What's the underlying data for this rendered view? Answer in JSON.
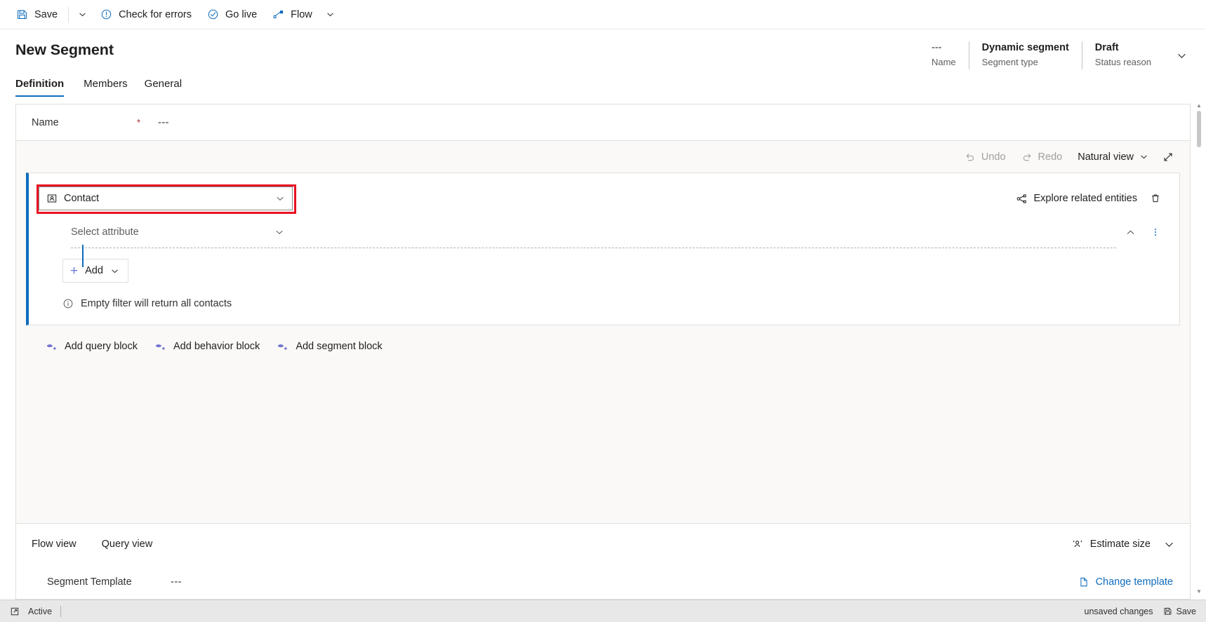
{
  "command_bar": {
    "items": [
      {
        "label": "Save",
        "icon": "save-icon",
        "name": "save-button"
      },
      {
        "label": "Check for errors",
        "icon": "error-circle-icon",
        "name": "check-for-errors-button"
      },
      {
        "label": "Go live",
        "icon": "checkmark-circle-icon",
        "name": "go-live-button"
      },
      {
        "label": "Flow",
        "icon": "flow-icon",
        "name": "flow-button"
      }
    ],
    "save_caret": "chevron-down-icon",
    "flow_caret": "chevron-down-icon"
  },
  "header": {
    "title": "New Segment",
    "fields": [
      {
        "value": "---",
        "label": "Name"
      },
      {
        "value": "Dynamic segment",
        "label": "Segment type"
      },
      {
        "value": "Draft",
        "label": "Status reason"
      }
    ],
    "expand_icon": "chevron-down-icon"
  },
  "tabs": [
    {
      "label": "Definition",
      "active": true
    },
    {
      "label": "Members",
      "active": false
    },
    {
      "label": "General",
      "active": false
    }
  ],
  "name_field": {
    "label": "Name",
    "required_marker": "*",
    "value": "---"
  },
  "canvas_toolbar": {
    "undo": "Undo",
    "redo": "Redo",
    "view_mode": "Natural view",
    "view_caret": "chevron-down-icon",
    "expand_icon": "expand-diagonal-icon"
  },
  "query_block": {
    "entity": {
      "value": "Contact",
      "icon": "contact-entity-icon",
      "caret": "chevron-down-icon"
    },
    "explore_related": {
      "label": "Explore related entities",
      "icon": "share-nodes-icon"
    },
    "delete_icon": "trash-icon",
    "attribute": {
      "placeholder": "Select attribute",
      "caret": "chevron-down-icon"
    },
    "collapse_icon": "chevron-up-icon",
    "more_icon": "more-vertical-icon",
    "add_button": {
      "label": "Add",
      "plus": "+",
      "caret": "chevron-down-icon"
    },
    "info": {
      "icon": "info-circle-icon",
      "text": "Empty filter will return all contacts"
    }
  },
  "add_blocks": [
    {
      "label": "Add query block",
      "icon": "add-block-icon"
    },
    {
      "label": "Add behavior block",
      "icon": "add-block-icon"
    },
    {
      "label": "Add segment block",
      "icon": "add-block-icon"
    }
  ],
  "bottom_panel": {
    "views": [
      {
        "label": "Flow view"
      },
      {
        "label": "Query view"
      }
    ],
    "estimate": {
      "label": "Estimate size",
      "icon": "people-icon",
      "caret": "chevron-down-icon"
    },
    "template_label": "Segment Template",
    "template_value": "---",
    "change_template": {
      "label": "Change template",
      "icon": "document-icon"
    }
  },
  "status_bar": {
    "state": "Active",
    "state_icon": "open-in-new-icon",
    "unsaved": "unsaved changes",
    "save": "Save",
    "save_icon": "save-icon"
  },
  "colors": {
    "accent": "#0f6cbd",
    "highlight_red": "#e81123",
    "required_red": "#a4262c",
    "canvas_bg": "#faf9f8",
    "statusbar_bg": "#e8e8e8"
  }
}
